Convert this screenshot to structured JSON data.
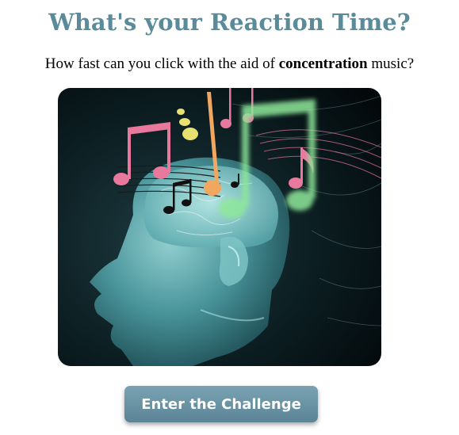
{
  "header": {
    "title": "What's your Reaction Time?"
  },
  "intro": {
    "text_before": "How fast can you click with the aid of ",
    "emphasis": "concentration",
    "text_after": " music?"
  },
  "hero": {
    "icon": "glass-head-music-notes-illustration"
  },
  "cta": {
    "label": "Enter the Challenge"
  },
  "colors": {
    "title": "#5a8b9a",
    "button": "#6a94a5",
    "note_pink": "#e8789c",
    "note_orange": "#f0a860",
    "note_yellow": "#e8e070",
    "note_green": "#8ee89a"
  }
}
